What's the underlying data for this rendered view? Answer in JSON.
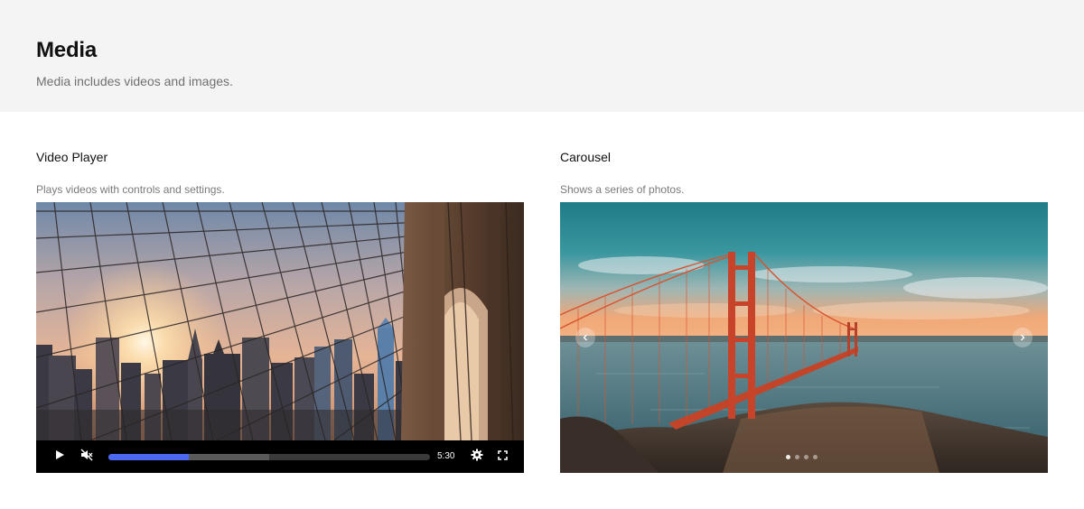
{
  "header": {
    "title": "Media",
    "subtitle": "Media includes videos and images."
  },
  "video_section": {
    "title": "Video Player",
    "description": "Plays videos with controls and settings.",
    "image_subject": "Brooklyn Bridge cables and city skyline at sunset",
    "controls": {
      "play_icon": "play-icon",
      "mute_icon": "muted-speaker-icon",
      "settings_icon": "gear-icon",
      "fullscreen_icon": "fullscreen-icon",
      "time": "5:30",
      "played_fraction": 0.25,
      "buffered_fraction": 0.5,
      "progress_color": "#4a68f2"
    }
  },
  "carousel_section": {
    "title": "Carousel",
    "description": "Shows a series of photos.",
    "image_subject": "Golden Gate Bridge over the bay under a teal and orange sky",
    "prev_icon": "chevron-left-icon",
    "next_icon": "chevron-right-icon",
    "slide_count": 4,
    "active_slide": 0
  }
}
